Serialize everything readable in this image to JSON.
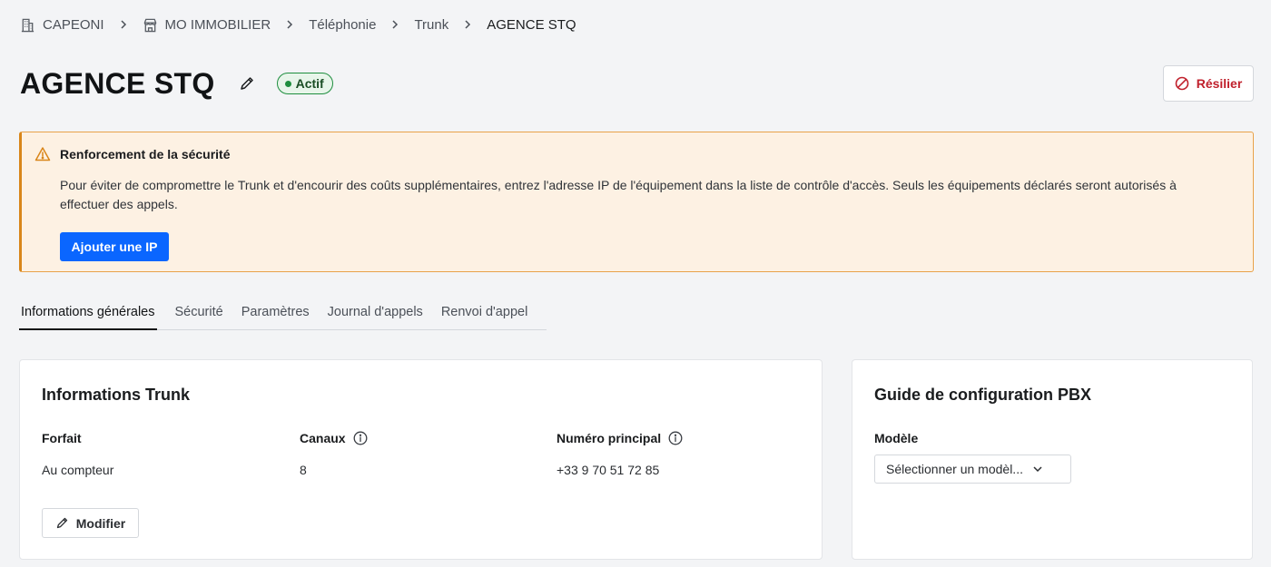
{
  "breadcrumb": {
    "items": [
      {
        "label": "CAPEONI",
        "icon": "building-icon"
      },
      {
        "label": "MO IMMOBILIER",
        "icon": "store-icon"
      },
      {
        "label": "Téléphonie"
      },
      {
        "label": "Trunk"
      },
      {
        "label": "AGENCE STQ"
      }
    ]
  },
  "header": {
    "title": "AGENCE STQ",
    "status": "Actif",
    "resilier_label": "Résilier"
  },
  "alert": {
    "title": "Renforcement de la sécurité",
    "text": "Pour éviter de compromettre le Trunk et d'encourir des coûts supplémentaires, entrez l'adresse IP de l'équipement dans la liste de contrôle d'accès. Seuls les équipements déclarés seront autorisés à effectuer des appels.",
    "button_label": "Ajouter une IP"
  },
  "tabs": [
    {
      "label": "Informations générales",
      "active": true
    },
    {
      "label": "Sécurité"
    },
    {
      "label": "Paramètres"
    },
    {
      "label": "Journal d'appels"
    },
    {
      "label": "Renvoi d'appel"
    }
  ],
  "trunk_card": {
    "title": "Informations Trunk",
    "fields": [
      {
        "label": "Forfait",
        "value": "Au compteur"
      },
      {
        "label": "Canaux",
        "value": "8"
      },
      {
        "label": "Numéro principal",
        "value": "+33 9 70 51 72 85"
      }
    ],
    "modify_label": "Modifier"
  },
  "pbx_card": {
    "title": "Guide de configuration PBX",
    "model_label": "Modèle",
    "model_placeholder": "Sélectionner un modèl..."
  },
  "colors": {
    "primary": "#0a66ff",
    "danger": "#c0202c",
    "success": "#1e8e3e",
    "warning_bg": "#fdf1e3",
    "warning_border": "#e8a24a"
  }
}
